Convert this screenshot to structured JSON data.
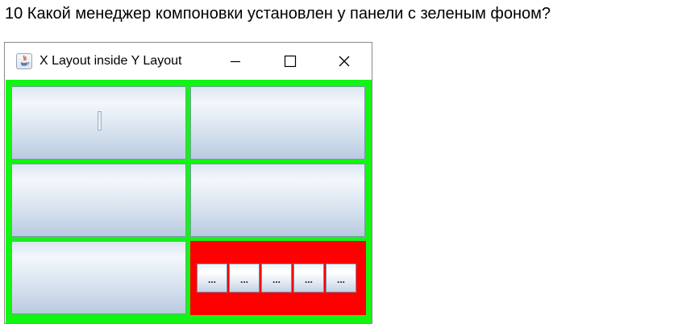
{
  "question": "10 Какой менеджер компоновки установлен у панели с зеленым фоном?",
  "window": {
    "title": "X Layout inside Y Layout",
    "icon": "java-icon",
    "controls": {
      "minimize_icon": "minimize-icon",
      "maximize_icon": "maximize-icon",
      "close_icon": "close-icon"
    }
  },
  "panel": {
    "background_color": "#12f512",
    "cells": 6,
    "inner_panel_color": "#ff0000",
    "inner_buttons": [
      "...",
      "...",
      "...",
      "...",
      "..."
    ]
  }
}
